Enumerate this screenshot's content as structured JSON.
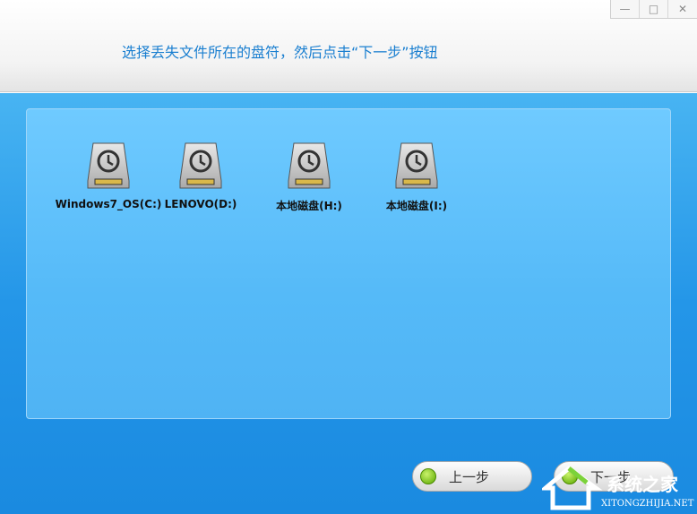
{
  "header": {
    "title": "选择丢失文件所在的盘符，然后点击“下一步”按钮"
  },
  "window_controls": {
    "minimize": "—",
    "maximize": "□",
    "close": "✕"
  },
  "drives": [
    {
      "label": "Windows7_OS(C:)",
      "icon": "hard-drive-icon"
    },
    {
      "label": "LENOVO(D:)",
      "icon": "hard-drive-icon"
    },
    {
      "label": "本地磁盘(H:)",
      "icon": "hard-drive-icon"
    },
    {
      "label": "本地磁盘(I:)",
      "icon": "hard-drive-icon"
    }
  ],
  "buttons": {
    "prev": "上一步",
    "next": "下一步"
  },
  "watermark": {
    "cn": "系统之家",
    "en": "XITONGZHIJIA.NET"
  }
}
